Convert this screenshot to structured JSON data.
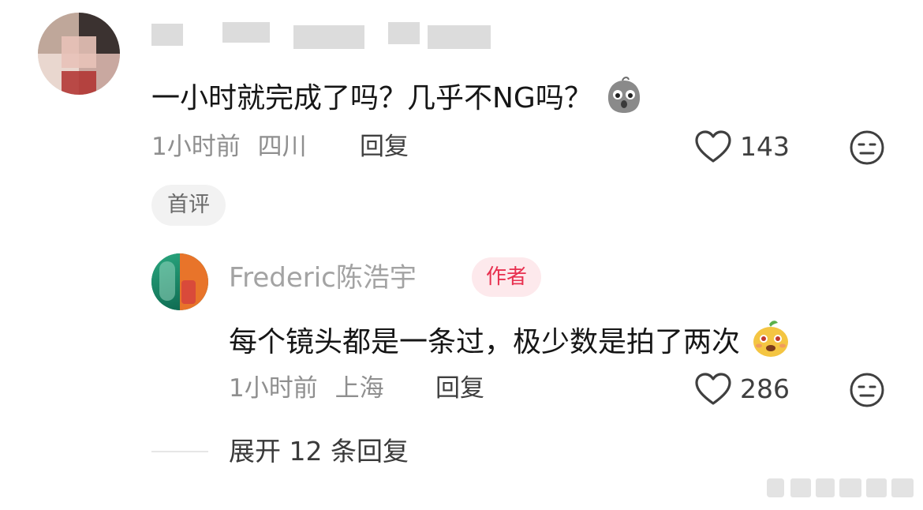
{
  "comment": {
    "text": "一小时就完成了吗？几乎不NG吗？",
    "emoji_icon": "shocked-face-emoji-icon",
    "time": "1小时前",
    "location": "四川",
    "reply_label": "回复",
    "likes": "143",
    "tag": "首评"
  },
  "reply": {
    "author": "Frederic陈浩宇",
    "badge": "作者",
    "text": "每个镜头都是一条过，极少数是拍了两次",
    "emoji_icon": "happy-fruit-emoji-icon",
    "time": "1小时前",
    "location": "上海",
    "reply_label": "回复",
    "likes": "286"
  },
  "expand_label": "展开 12 条回复",
  "colors": {
    "text": "#161616",
    "meta": "#8f8f8f",
    "author_badge_bg": "#fde9ec",
    "author_badge_text": "#e8304f",
    "tag_bg": "#f2f2f2"
  }
}
